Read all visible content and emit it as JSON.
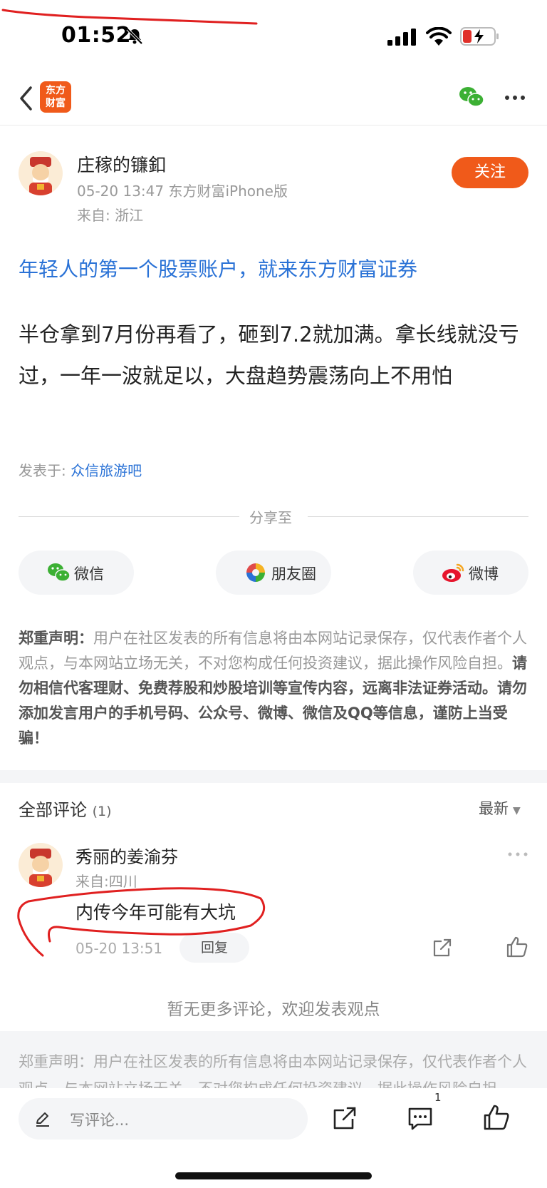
{
  "status_bar": {
    "time": "01:52"
  },
  "nav": {
    "logo_line1": "东方",
    "logo_line2": "财富"
  },
  "author": {
    "name": "庄稼的镰釦",
    "meta": "05-20 13:47 东方财富iPhone版",
    "location": "来自: 浙江",
    "follow_label": "关注"
  },
  "promo": "年轻人的第一个股票账户，就来东方财富证券",
  "post": {
    "content": "半仓拿到7月份再看了，砸到7.2就加满。拿长线就没亏过，一年一波就足以，大盘趋势震荡向上不用怕"
  },
  "posted_in": {
    "label": "发表于: ",
    "forum": "众信旅游吧"
  },
  "share": {
    "label": "分享至",
    "buttons": [
      {
        "label": "微信",
        "icon": "wechat-icon"
      },
      {
        "label": "朋友圈",
        "icon": "moments-icon"
      },
      {
        "label": "微博",
        "icon": "weibo-icon"
      }
    ]
  },
  "disclaimer": {
    "heading": "郑重声明：",
    "part1": "用户在社区发表的所有信息将由本网站记录保存，仅代表作者个人观点，与本网站立场无关，不对您构成任何投资建议，据此操作风险自担。",
    "part2": "请勿相信代客理财、免费荐股和炒股培训等宣传内容，远离非法证券活动。请勿添加发言用户的手机号码、公众号、微博、微信及QQ等信息，谨防上当受骗！"
  },
  "comments": {
    "title": "全部评论",
    "count": "(1)",
    "sort": "最新",
    "items": [
      {
        "name": "秀丽的姜渝芬",
        "location": "来自:四川",
        "text": "内传今年可能有大坑",
        "time": "05-20 13:51",
        "reply_label": "回复"
      }
    ],
    "no_more": "暂无更多评论，欢迎发表观点"
  },
  "bottom_disclaimer": "郑重声明：用户在社区发表的所有信息将由本网站记录保存，仅代表作者个人观点，与本网站立场无关，不对您构成任何投资建议，据此操作风险自担。",
  "bottom_bar": {
    "placeholder": "写评论...",
    "comment_count": "1"
  },
  "colors": {
    "brand": "#f05a1a",
    "link": "#2a72d6",
    "annotation": "#e02020"
  }
}
